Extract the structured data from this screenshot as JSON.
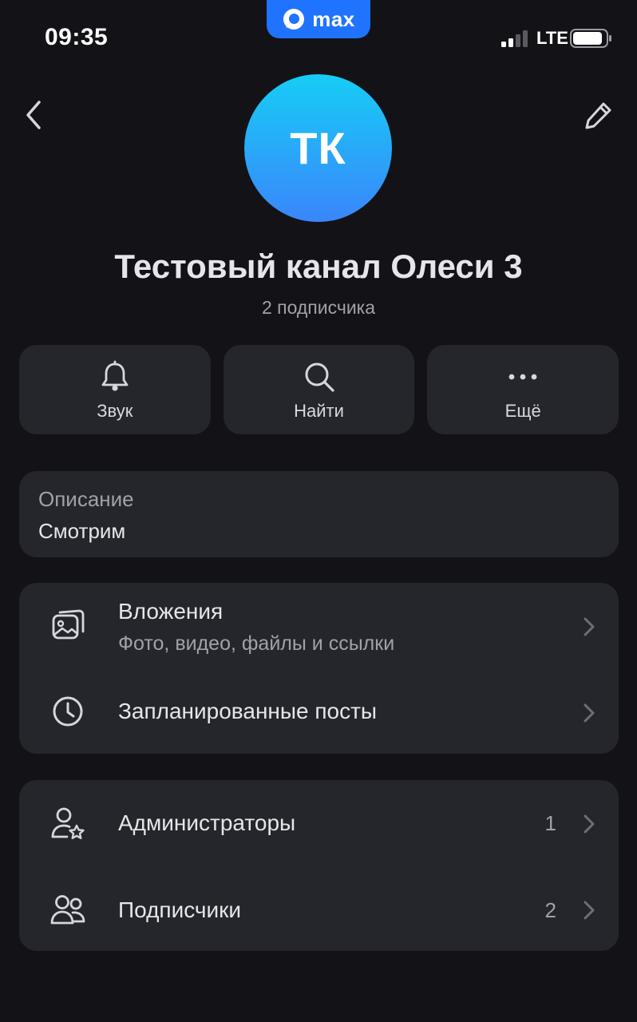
{
  "status_bar": {
    "time": "09:35",
    "app_name": "max",
    "network": "LTE"
  },
  "nav": {
    "back_icon": "chevron-left-icon",
    "edit_icon": "pencil-icon"
  },
  "channel": {
    "avatar_initials": "ТК",
    "title": "Тестовый канал Олеси 3",
    "subscribers": "2 подписчика"
  },
  "actions": [
    {
      "label": "Звук",
      "icon": "bell-icon"
    },
    {
      "label": "Найти",
      "icon": "search-icon"
    },
    {
      "label": "Ещё",
      "icon": "more-dots-icon"
    }
  ],
  "description": {
    "label": "Описание",
    "value": "Смотрим"
  },
  "media_section": {
    "attachments": {
      "title": "Вложения",
      "subtitle": "Фото, видео, файлы и ссылки",
      "icon": "gallery-icon"
    },
    "scheduled": {
      "title": "Запланированные посты",
      "icon": "clock-icon"
    }
  },
  "members_section": {
    "admins": {
      "title": "Администраторы",
      "count": "1",
      "icon": "admin-star-icon"
    },
    "subscribers": {
      "title": "Подписчики",
      "count": "2",
      "icon": "users-icon"
    }
  },
  "colors": {
    "background": "#121217",
    "card": "#25262c",
    "accent": "#1f73ff",
    "avatar_top": "#16cdf6",
    "avatar_bottom": "#3a86fb"
  }
}
